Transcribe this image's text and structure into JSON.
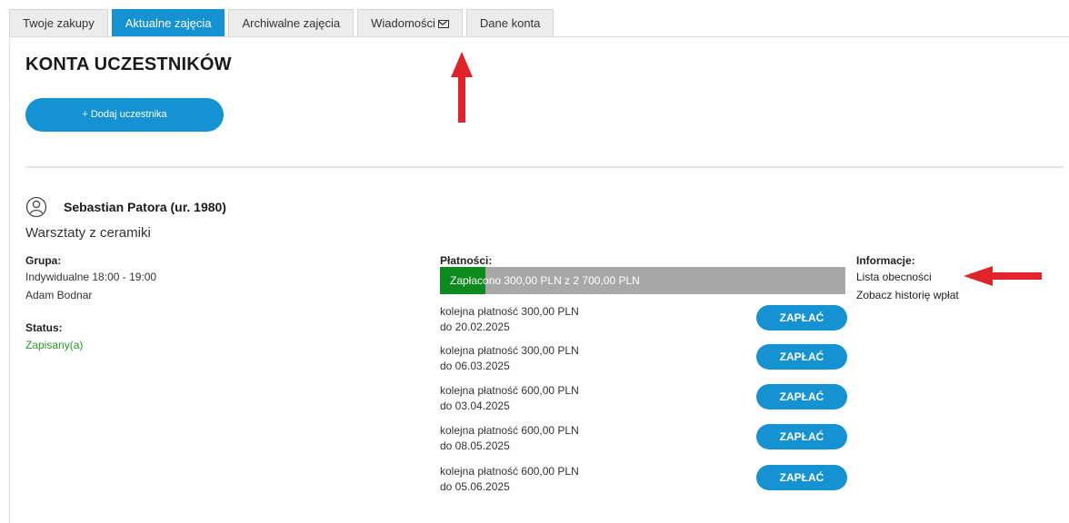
{
  "tabs": [
    {
      "label": "Twoje zakupy",
      "active": false
    },
    {
      "label": "Aktualne zajęcia",
      "active": true
    },
    {
      "label": "Archiwalne zajęcia",
      "active": false
    },
    {
      "label": "Wiadomości",
      "active": false,
      "icon": "envelope-icon"
    },
    {
      "label": "Dane konta",
      "active": false
    }
  ],
  "page": {
    "title": "KONTA UCZESTNIKÓW",
    "add_button": "+ Dodaj uczestnika"
  },
  "participant": {
    "icon": "person-icon",
    "name": "Sebastian Patora (ur. 1980)",
    "course": "Warsztaty z ceramiki",
    "group_label": "Grupa:",
    "group_time": "Indywidualne 18:00 - 19:00",
    "group_teacher": "Adam Bodnar",
    "status_label": "Status:",
    "status_value": "Zapisany(a)",
    "status_color": "#2a9a2a"
  },
  "payments": {
    "label": "Płatności:",
    "progress_text": "Zapłacono 300,00 PLN z 2 700,00 PLN",
    "paid_fraction": 0.111,
    "fill_color": "#0d8a1d",
    "installments": [
      {
        "line1": "kolejna płatność 300,00 PLN",
        "line2": "do 20.02.2025",
        "button": "ZAPŁAĆ"
      },
      {
        "line1": "kolejna płatność 300,00 PLN",
        "line2": "do 06.03.2025",
        "button": "ZAPŁAĆ"
      },
      {
        "line1": "kolejna płatność 600,00 PLN",
        "line2": "do 03.04.2025",
        "button": "ZAPŁAĆ"
      },
      {
        "line1": "kolejna płatność 600,00 PLN",
        "line2": "do 08.05.2025",
        "button": "ZAPŁAĆ"
      },
      {
        "line1": "kolejna płatność 600,00 PLN",
        "line2": "do 05.06.2025",
        "button": "ZAPŁAĆ"
      }
    ]
  },
  "info": {
    "label": "Informacje:",
    "link_attendance": "Lista obecności",
    "link_history": "Zobacz historię wpłat"
  },
  "colors": {
    "accent": "#1592d1",
    "annotation_arrow": "#e3232b"
  }
}
